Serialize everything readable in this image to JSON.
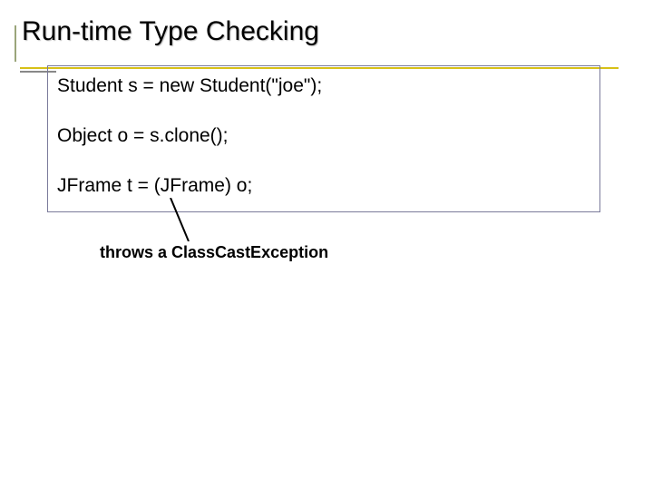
{
  "title": "Run-time Type Checking",
  "code": {
    "line1": "Student s = new Student(\"joe\");",
    "line2": "Object o = s.clone();",
    "line3": "JFrame t = (JFrame) o;"
  },
  "caption": "throws a ClassCastException"
}
